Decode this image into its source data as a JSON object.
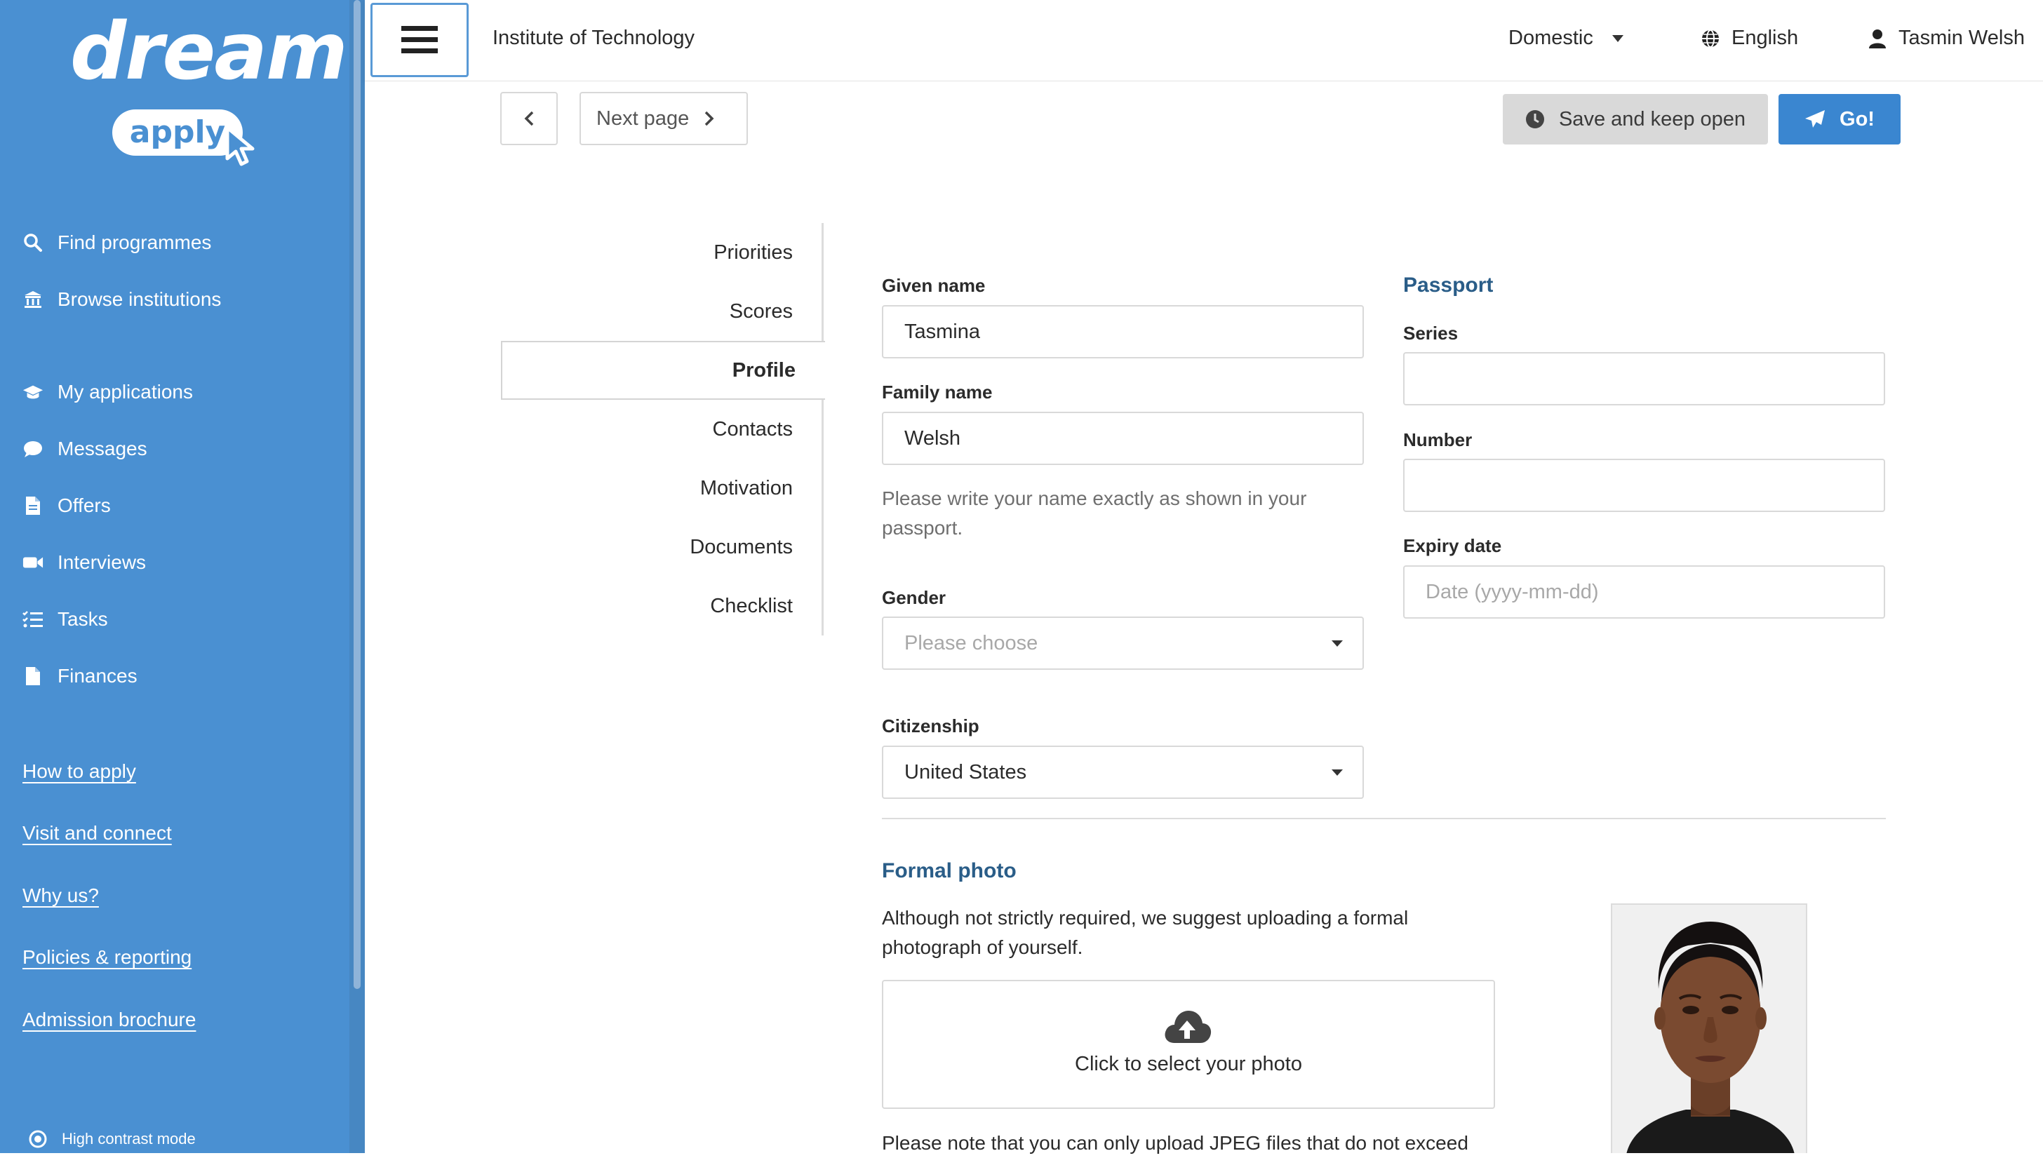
{
  "sidebar": {
    "logo": {
      "word": "dream",
      "pill": "apply"
    },
    "primary_nav": [
      {
        "label": "Find programmes",
        "icon": "search-icon"
      },
      {
        "label": "Browse institutions",
        "icon": "institution-icon"
      }
    ],
    "account_nav": [
      {
        "label": "My applications",
        "icon": "graduation-cap-icon"
      },
      {
        "label": "Messages",
        "icon": "chat-bubble-icon"
      },
      {
        "label": "Offers",
        "icon": "document-icon"
      },
      {
        "label": "Interviews",
        "icon": "video-camera-icon"
      },
      {
        "label": "Tasks",
        "icon": "task-list-icon"
      },
      {
        "label": "Finances",
        "icon": "file-icon"
      }
    ],
    "links": [
      "How to apply",
      "Visit and connect",
      "Why us?",
      "Policies & reporting",
      "Admission brochure"
    ],
    "high_contrast": "High contrast mode",
    "color": "#4a90d2"
  },
  "topbar": {
    "institution": "Institute of Technology",
    "region": "Domestic",
    "language": "English",
    "user": "Tasmin Welsh"
  },
  "actions": {
    "next_page": "Next page",
    "save_keep_open": "Save and keep open",
    "go": "Go!",
    "go_color": "#3a86d0"
  },
  "section_tabs": [
    {
      "label": "Priorities",
      "active": false
    },
    {
      "label": "Scores",
      "active": false
    },
    {
      "label": "Profile",
      "active": true
    },
    {
      "label": "Contacts",
      "active": false
    },
    {
      "label": "Motivation",
      "active": false
    },
    {
      "label": "Documents",
      "active": false
    },
    {
      "label": "Checklist",
      "active": false
    }
  ],
  "profile": {
    "given_name_label": "Given name",
    "given_name_value": "Tasmina",
    "family_name_label": "Family name",
    "family_name_value": "Welsh",
    "name_hint": "Please write your name exactly as shown in your passport.",
    "gender_label": "Gender",
    "gender_placeholder": "Please choose",
    "citizenship_label": "Citizenship",
    "citizenship_value": "United States"
  },
  "passport": {
    "title": "Passport",
    "series_label": "Series",
    "series_value": "",
    "number_label": "Number",
    "number_value": "",
    "expiry_label": "Expiry date",
    "expiry_placeholder": "Date (yyyy-mm-dd)"
  },
  "photo": {
    "title": "Formal photo",
    "description": "Although not strictly required, we suggest uploading a formal photograph of yourself.",
    "upload_label": "Click to select your photo",
    "note": "Please note that you can only upload JPEG files that do not exceed"
  }
}
